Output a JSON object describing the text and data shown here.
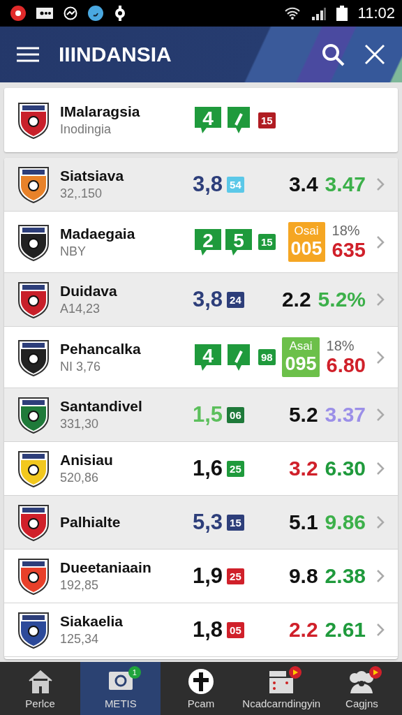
{
  "status_bar": {
    "time": "11:02"
  },
  "header": {
    "title": "IIINDANSIA"
  },
  "featured": {
    "name": "IMalaragsia",
    "sub": "Inodingia",
    "color": "#c8202a",
    "bubbles": [
      {
        "kind": "text",
        "text": "4"
      },
      {
        "kind": "mark"
      }
    ],
    "badge": {
      "text": "15",
      "color": "#b01c22"
    }
  },
  "rows": [
    {
      "name": "Siatsiava",
      "sub": "32,.150",
      "color": "#e8822a",
      "shaded": true,
      "score": {
        "kind": "plain",
        "text": "3,8",
        "color": "#2d3e7a"
      },
      "badge": {
        "text": "54",
        "color": "#5bc8e8"
      },
      "right": {
        "kind": "pair",
        "a": {
          "text": "3.4",
          "color": "#111111"
        },
        "b": {
          "text": "3.47",
          "color": "#3cb04a"
        }
      }
    },
    {
      "name": "Madaegaia",
      "sub": "NBY",
      "color": "#222222",
      "shaded": false,
      "score": {
        "kind": "bubble",
        "bubbles": [
          {
            "kind": "text",
            "text": "2"
          },
          {
            "kind": "text",
            "text": "5"
          }
        ]
      },
      "badge": {
        "text": "15",
        "color": "#1f9a3c"
      },
      "right": {
        "kind": "boxed",
        "box": {
          "label": "Osai",
          "value": "005",
          "color": "#f5a623"
        },
        "pct": "18%",
        "value": "635"
      }
    },
    {
      "name": "Duidava",
      "sub": "A14,23",
      "color": "#c8202a",
      "shaded": true,
      "score": {
        "kind": "plain",
        "text": "3,8",
        "color": "#2d3e7a"
      },
      "badge": {
        "text": "24",
        "color": "#2d3e7a"
      },
      "right": {
        "kind": "pair",
        "a": {
          "text": "2.2",
          "color": "#111111"
        },
        "b": {
          "text": "5.2%",
          "color": "#3cb04a"
        }
      }
    },
    {
      "name": "Pehancalka",
      "sub": "NI 3,76",
      "color": "#222222",
      "shaded": false,
      "score": {
        "kind": "bubble",
        "bubbles": [
          {
            "kind": "text",
            "text": "4"
          },
          {
            "kind": "mark"
          }
        ]
      },
      "badge": {
        "text": "98",
        "color": "#1f9a3c"
      },
      "right": {
        "kind": "boxed",
        "box": {
          "label": "Asai",
          "value": "095",
          "color": "#6cc04a"
        },
        "pct": "18%",
        "value": "6.80"
      }
    },
    {
      "name": "Santandivel",
      "sub": "331,30",
      "color": "#1f7a3a",
      "shaded": true,
      "score": {
        "kind": "plain",
        "text": "1,5",
        "color": "#5cbf5c"
      },
      "badge": {
        "text": "06",
        "color": "#1f7a3a"
      },
      "right": {
        "kind": "pair",
        "a": {
          "text": "5.2",
          "color": "#111111"
        },
        "b": {
          "text": "3.37",
          "color": "#9b8fe8"
        }
      }
    },
    {
      "name": "Anisiau",
      "sub": "520,86",
      "color": "#f2c81e",
      "shaded": false,
      "score": {
        "kind": "plain",
        "text": "1,6",
        "color": "#111111"
      },
      "badge": {
        "text": "25",
        "color": "#1f9a3c"
      },
      "right": {
        "kind": "pair",
        "a": {
          "text": "3.2",
          "color": "#d0202a"
        },
        "b": {
          "text": "6.30",
          "color": "#1f9a3c"
        }
      }
    },
    {
      "name": "Palhialte",
      "color": "#d0202a",
      "shaded": true,
      "score": {
        "kind": "plain",
        "text": "5,3",
        "color": "#2d3e7a"
      },
      "badge": {
        "text": "15",
        "color": "#2d3e7a"
      },
      "right": {
        "kind": "pair",
        "a": {
          "text": "5.1",
          "color": "#111111"
        },
        "b": {
          "text": "9.86",
          "color": "#3cb04a"
        }
      }
    },
    {
      "name": "Dueetaniaain",
      "sub": "192,85",
      "color": "#e8402a",
      "shaded": false,
      "score": {
        "kind": "plain",
        "text": "1,9",
        "color": "#111111"
      },
      "badge": {
        "text": "25",
        "color": "#d0202a"
      },
      "right": {
        "kind": "pair",
        "a": {
          "text": "9.8",
          "color": "#111111"
        },
        "b": {
          "text": "2.38",
          "color": "#1f9a3c"
        }
      }
    },
    {
      "name": "Siakaelia",
      "sub": "125,34",
      "color": "#2d4a9a",
      "shaded": false,
      "score": {
        "kind": "plain",
        "text": "1,8",
        "color": "#111111"
      },
      "badge": {
        "text": "05",
        "color": "#d0202a"
      },
      "right": {
        "kind": "pair",
        "a": {
          "text": "2.2",
          "color": "#d0202a"
        },
        "b": {
          "text": "2.61",
          "color": "#1f9a3c"
        }
      }
    }
  ],
  "nav": [
    {
      "label": "Perlce",
      "kind": "home",
      "selected": false
    },
    {
      "label": "METIS",
      "kind": "screen",
      "selected": true,
      "badge": {
        "kind": "count",
        "text": "1",
        "color": "#1fa33c"
      }
    },
    {
      "label": "Pcam",
      "kind": "circle",
      "selected": false
    },
    {
      "label": "Ncadcarndingyin",
      "kind": "panel",
      "selected": false,
      "badge": {
        "kind": "dot",
        "color": "#d0202a"
      }
    },
    {
      "label": "Cagjns",
      "kind": "group",
      "selected": false,
      "badge": {
        "kind": "dot",
        "color": "#d0202a"
      }
    }
  ]
}
